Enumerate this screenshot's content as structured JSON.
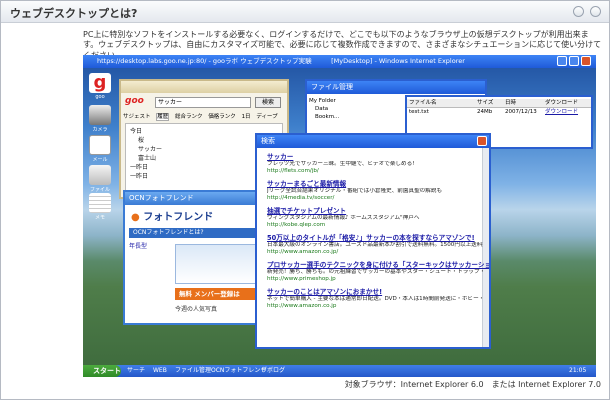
{
  "panel": {
    "title": "ウェブデスクトップとは?"
  },
  "intro": "PC上に特別なソフトをインストールする必要なく、ログインするだけで、どこでも以下のようなブラウザ上の仮想デスクトップが利用出来ます。ウェブデスクトップは、自由にカスタマイズ可能で、必要に応じて複数作成できますので、さまざまなシチュエーションに応じて使い分けてください。",
  "browser": {
    "title": "https://desktop.labs.goo.ne.jp:80/ - gooラボ ウェブデスクトップ実験　　　[MyDesktop] - Windows Internet Explorer"
  },
  "goo_search": {
    "logo": "goo",
    "query": "サッカー",
    "button": "検索",
    "tabs": [
      "サジェスト",
      "履歴",
      "総合ランク",
      "価格ランク",
      "1日",
      "ディープ"
    ],
    "tree": [
      "今日",
      "桜",
      "サッカー",
      "富士山",
      "一昨日",
      "一昨日"
    ]
  },
  "file_manager": {
    "title": "ファイル管理",
    "folders": [
      "My Folder",
      "Data",
      "Bookm..."
    ],
    "columns": [
      "ファイル名",
      "サイズ",
      "日時",
      "ダウンロード"
    ],
    "rows": [
      {
        "name": "test.txt",
        "size": "24Mb",
        "date": "2007/12/13",
        "dl": "ダウンロード"
      }
    ]
  },
  "results_window": {
    "title": "検索",
    "results": [
      {
        "title": "サッカー",
        "desc": "フレッツ光でサッカー三昧。生中継で、ビデオで楽しめる!",
        "url": "http://flets.com/jb/"
      },
      {
        "title": "サッカーまるごと最新情報",
        "desc": "Jリーグ全試合結果オリジナル・番組では小倉隆史、前園真聖の解説も",
        "url": "http://4media.tv/soccer/"
      },
      {
        "title": "抽選でチケットプレゼント",
        "desc": "ウィングスタジアムの最新情報♪ ホームズスタジアム\"神戸へ",
        "url": "http://kobe.qlep.com"
      },
      {
        "title": "50万以上のタイトルが「格安♪」サッカーの本を探すならアマゾンで!",
        "desc": "日本最大級のオンライン書店。ユーズド品最新本が割引で送料無料。1500円以上送料無料。最短翌日お届け、書籍販売ランキングも公開! 1000種類以上のDVDが特価!",
        "url": "http://www.amazon.co.jp/"
      },
      {
        "title": "プロサッカー選手のテクニックを身に付ける「スターキックはサッカーショップのプライムショップへ」",
        "desc": "新発売！勝ち、勝ちも。の元祖練習でサッカーの基本やスター・シュート・トラップ・パス・リフティングを。1ヶ月間お得なキャンペーン中",
        "url": "http://www.primeshop.jp"
      },
      {
        "title": "サッカーのことはアマゾンにおまかせ!",
        "desc": "ネットで簡単購入 - 主要な本は通常即日配送。DVD・本人は1時間前発送に・ホビー・等",
        "url": "http://www.amazon.co.jp"
      }
    ]
  },
  "friend_window": {
    "title": "OCNフォトフレンド",
    "heading": "OCNフォトフレンドとは?",
    "logo": "フォトフレンド",
    "banner": "無料 メンバー登録は",
    "caption": "今週の人気写真",
    "side_label": "年長型"
  },
  "desktop_icons": [
    "goo",
    "カメラ",
    "メール",
    "ファイル",
    "メモ"
  ],
  "taskbar": {
    "start": "スタート",
    "items": [
      "サーチ",
      "WEB",
      "ファイル管理",
      "OCNフォトフレンド",
      "ヴボログ"
    ],
    "clock": "21:05"
  },
  "footer": "対象ブラウザ：Internet Explorer 6.0　または Internet Explorer 7.0",
  "colors": {
    "xp_blue": "#2b5fd0",
    "link": "#1a1aa6",
    "url_green": "#1a7a1a",
    "ocn_orange": "#e8701a"
  }
}
